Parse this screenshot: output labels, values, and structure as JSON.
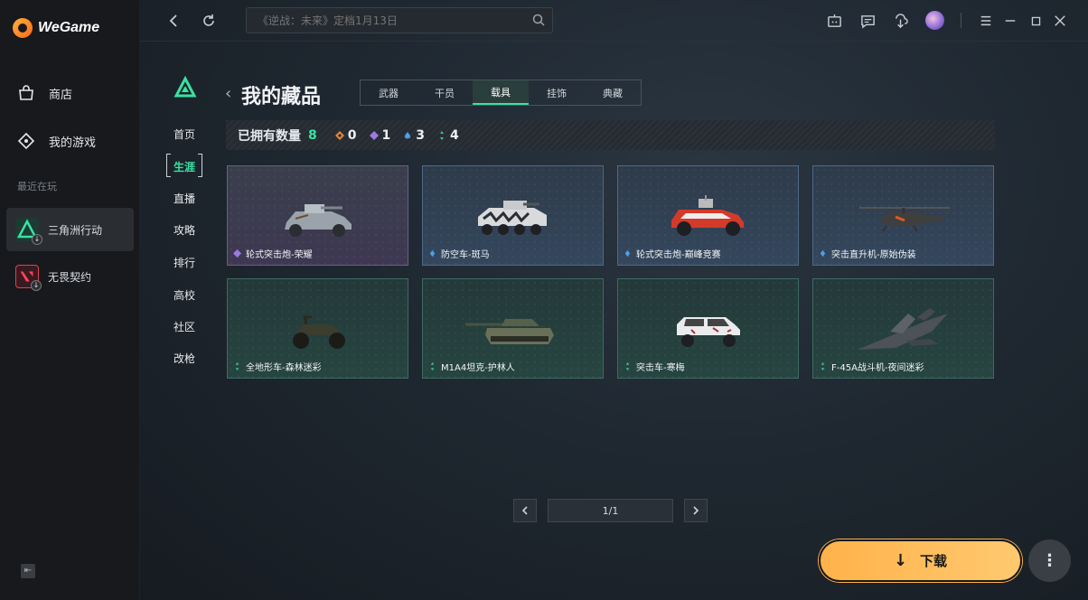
{
  "app": {
    "name": "WeGame"
  },
  "sidebar": {
    "nav": [
      {
        "label": "商店",
        "icon": "shop-bag-icon"
      },
      {
        "label": "我的游戏",
        "icon": "gamepad-icon"
      }
    ],
    "recent_label": "最近在玩",
    "games": [
      {
        "label": "三角洲行动",
        "active": true
      },
      {
        "label": "无畏契约",
        "active": false
      }
    ]
  },
  "topbar": {
    "search_placeholder": "《逆战：未来》定档1月13日"
  },
  "game_nav": [
    "首页",
    "生涯",
    "直播",
    "攻略",
    "排行",
    "高校",
    "社区",
    "改枪"
  ],
  "game_nav_active": "生涯",
  "collection": {
    "title": "我的藏品",
    "tabs": [
      "武器",
      "干员",
      "载具",
      "挂饰",
      "典藏"
    ],
    "active_tab": "载具",
    "owned_label": "已拥有数量",
    "owned_total": "8",
    "counts": [
      {
        "rarity": "gold",
        "color": "#e0883a",
        "value": "0"
      },
      {
        "rarity": "purple",
        "color": "#9b7ae0",
        "value": "1"
      },
      {
        "rarity": "blue",
        "color": "#4e9fe8",
        "value": "3"
      },
      {
        "rarity": "green",
        "color": "#39c29a",
        "value": "4"
      }
    ],
    "items": [
      {
        "name": "轮式突击炮-荣耀",
        "rarity": "purple",
        "vehicle": "armored-car"
      },
      {
        "name": "防空车-斑马",
        "rarity": "blue",
        "vehicle": "apc"
      },
      {
        "name": "轮式突击炮-巅峰竞赛",
        "rarity": "blue",
        "vehicle": "buggy"
      },
      {
        "name": "突击直升机-原始伪装",
        "rarity": "blue",
        "vehicle": "helicopter"
      },
      {
        "name": "全地形车-森林迷彩",
        "rarity": "green",
        "vehicle": "atv"
      },
      {
        "name": "M1A4坦克-护林人",
        "rarity": "green",
        "vehicle": "tank"
      },
      {
        "name": "突击车-寒梅",
        "rarity": "green",
        "vehicle": "suv"
      },
      {
        "name": "F-45A战斗机-夜间迷彩",
        "rarity": "green",
        "vehicle": "jet"
      }
    ]
  },
  "pagination": {
    "label": "1/1"
  },
  "download": {
    "label": "下载"
  }
}
